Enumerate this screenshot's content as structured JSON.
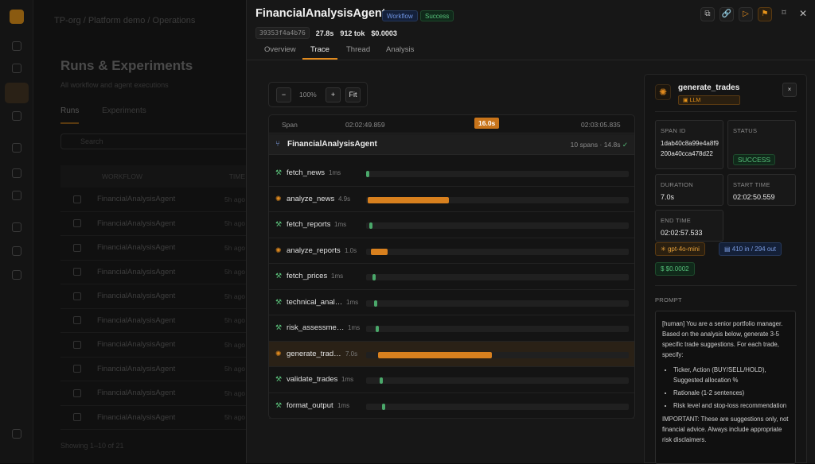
{
  "background": {
    "breadcrumb": [
      "TP-org",
      "Platform demo",
      "Operations"
    ],
    "page_title": "Runs & Experiments",
    "page_subtitle": "All workflow and agent executions",
    "tabs": [
      "Runs",
      "Experiments"
    ],
    "search_placeholder": "Search",
    "columns": [
      "WORKFLOW",
      "TIME"
    ],
    "rows": [
      "FinancialAnalysisAgent",
      "FinancialAnalysisAgent",
      "FinancialAnalysisAgent",
      "FinancialAnalysisAgent",
      "FinancialAnalysisAgent",
      "FinancialAnalysisAgent",
      "FinancialAnalysisAgent",
      "FinancialAnalysisAgent",
      "FinancialAnalysisAgent",
      "FinancialAnalysisAgent"
    ],
    "row_time": "5h ago",
    "footer": "Showing 1–10 of 21"
  },
  "header": {
    "title": "FinancialAnalysisAgent",
    "badge_type": "Workflow",
    "badge_status": "Success",
    "run_id": "39353f4a4b76",
    "duration": "27.8s",
    "tokens": "912 tok",
    "cost": "$0.0003"
  },
  "tabs": [
    "Overview",
    "Trace",
    "Thread",
    "Analysis"
  ],
  "zoom": {
    "minus": "−",
    "value": "100%",
    "plus": "+",
    "fit": "Fit"
  },
  "timeline": {
    "col_label": "Span",
    "t_start": "02:02:49.859",
    "marker": "16.0s",
    "t_end": "02:03:05.835",
    "root_name": "FinancialAnalysisAgent",
    "root_summary": "10 spans · 14.8s",
    "root_check": "✓",
    "spans": [
      {
        "name": "fetch_news",
        "dur": "1ms",
        "kind": "tool",
        "start": 0.0,
        "width": 0.012
      },
      {
        "name": "analyze_news",
        "dur": "4.9s",
        "kind": "llm",
        "start": 0.005,
        "width": 0.31
      },
      {
        "name": "fetch_reports",
        "dur": "1ms",
        "kind": "tool",
        "start": 0.012,
        "width": 0.012
      },
      {
        "name": "analyze_reports",
        "dur": "1.0s",
        "kind": "llm",
        "start": 0.018,
        "width": 0.065
      },
      {
        "name": "fetch_prices",
        "dur": "1ms",
        "kind": "tool",
        "start": 0.025,
        "width": 0.012
      },
      {
        "name": "technical_anal…",
        "dur": "1ms",
        "kind": "tool",
        "start": 0.03,
        "width": 0.012
      },
      {
        "name": "risk_assessme…",
        "dur": "1ms",
        "kind": "tool",
        "start": 0.037,
        "width": 0.012
      },
      {
        "name": "generate_trad…",
        "dur": "7.0s",
        "kind": "llm",
        "start": 0.045,
        "width": 0.435,
        "selected": true
      },
      {
        "name": "validate_trades",
        "dur": "1ms",
        "kind": "tool",
        "start": 0.052,
        "width": 0.012
      },
      {
        "name": "format_output",
        "dur": "1ms",
        "kind": "tool",
        "start": 0.06,
        "width": 0.012
      }
    ]
  },
  "detail": {
    "name": "generate_trades",
    "tag": "LLM",
    "close": "×",
    "span_id_label": "SPAN ID",
    "span_id": "1dab40c8a99e4a8f9200a40cca478d22",
    "status_label": "STATUS",
    "status": "SUCCESS",
    "duration_label": "DURATION",
    "duration": "7.0s",
    "start_label": "START TIME",
    "start": "02:02:50.559",
    "end_label": "END TIME",
    "end": "02:02:57.533",
    "model": "gpt-4o-mini",
    "tokens": "410 in / 294 out",
    "cost": "$0.0002",
    "prompt_label": "PROMPT",
    "prompt_intro": "[human] You are a senior portfolio manager. Based on the analysis below, generate 3-5 specific trade suggestions. For each trade, specify:",
    "prompt_items": [
      "Ticker, Action (BUY/SELL/HOLD), Suggested allocation %",
      "Rationale (1-2 sentences)",
      "Risk level and stop-loss recommendation"
    ],
    "prompt_outro": "IMPORTANT: These are suggestions only, not financial advice. Always include appropriate risk disclaimers."
  },
  "colors": {
    "accent": "#e08a1e",
    "success": "#56c07a",
    "info": "#7a9be0",
    "bar_llm": "#d8801e",
    "bar_tool": "#4aa86a"
  }
}
